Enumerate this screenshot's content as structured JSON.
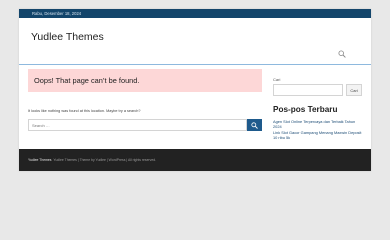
{
  "topbar": {
    "date": "Rabu, Desember 18, 2024"
  },
  "site": {
    "title": "Yudlee Themes"
  },
  "main": {
    "heading": "Oops! That page can’t be found.",
    "message": "It looks like nothing was found at this location. Maybe try a search?",
    "search_placeholder": "Search …",
    "search_button_icon": "search-icon"
  },
  "sidebar": {
    "search_label": "Cari",
    "search_button": "Cari",
    "heading": "Pos-pos Terbaru",
    "posts": [
      "Agen Slot Online Terpercaya dan Terbaik Tahun 2024",
      "Link Slot Gacor Gampang Menang Maxwin Deposit 10 ribu 5k"
    ]
  },
  "footer": {
    "brand": "Yudlee Themes",
    "text": "  Yudlee Themes | Theme by Yudlee | WordPress | All rights reserved."
  },
  "colors": {
    "topbar": "#13456b",
    "accent": "#1e5a8c",
    "notfound_bg": "#fdd7d7",
    "footer": "#222222"
  }
}
